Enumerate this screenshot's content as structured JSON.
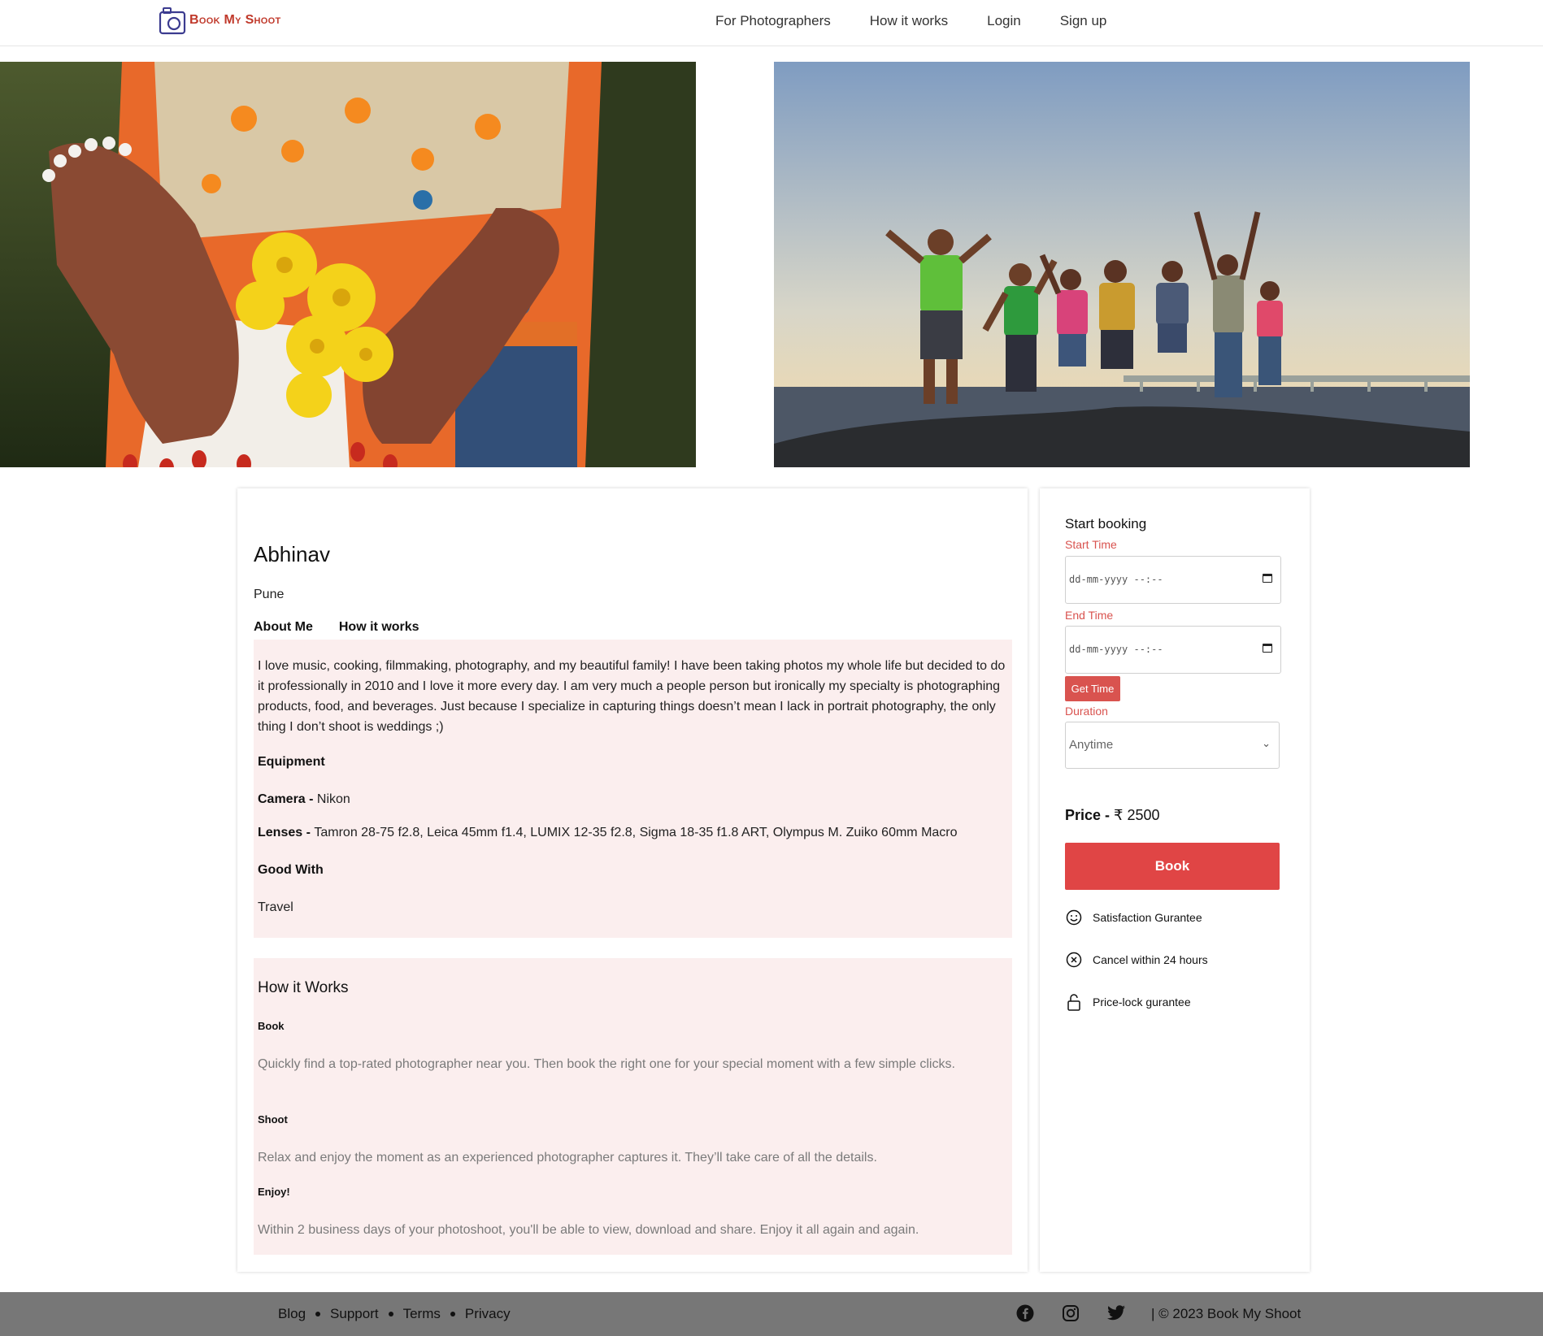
{
  "header": {
    "logo_text": "Book My Shoot",
    "nav": [
      "For Photographers",
      "How it works",
      "Login",
      "Sign up"
    ]
  },
  "profile": {
    "name": "Abhinav",
    "city": "Pune",
    "tabs": [
      "About Me",
      "How it works"
    ],
    "about": "I love music, cooking, filmmaking, photography, and my beautiful family! I have been taking photos my whole life but decided to do it professionally in 2010 and I love it more every day. I am very much a people person but ironically my specialty is photographing products, food, and beverages. Just because I specialize in capturing things doesn’t mean I lack in portrait photography, the only thing I don’t shoot is weddings ;)",
    "equipment_heading": "Equipment",
    "camera_label": "Camera - ",
    "camera_value": "Nikon",
    "lenses_label": "Lenses - ",
    "lenses_value": "Tamron 28-75 f2.8, Leica 45mm f1.4, LUMIX 12-35 f2.8, Sigma 18-35 f1.8 ART, Olympus M. Zuiko 60mm Macro",
    "good_with_heading": "Good With",
    "good_with_value": "Travel"
  },
  "how_it_works": {
    "title": "How it Works",
    "steps": [
      {
        "title": "Book",
        "desc": "Quickly find a top-rated photographer near you. Then book the right one for your special moment with a few simple clicks."
      },
      {
        "title": "Shoot",
        "desc": "Relax and enjoy the moment as an experienced photographer captures it. They’ll take care of all the details."
      },
      {
        "title": "Enjoy!",
        "desc": "Within 2 business days of your photoshoot, you'll be able to view, download and share. Enjoy it all again and again."
      }
    ]
  },
  "booking": {
    "title": "Start booking",
    "start_label": "Start Time",
    "end_label": "End Time",
    "datetime_placeholder": "dd-mm-yyyy --:--",
    "get_time": "Get Time",
    "duration_label": "Duration",
    "duration_value": "Anytime",
    "price_label": "Price - ",
    "price_value": "₹ 2500",
    "book": "Book",
    "features": [
      "Satisfaction Gurantee",
      "Cancel within 24 hours",
      "Price-lock gurantee"
    ]
  },
  "footer": {
    "links": [
      "Blog",
      "Support",
      "Terms",
      "Privacy"
    ],
    "social": [
      "facebook-icon",
      "instagram-icon",
      "twitter-icon"
    ],
    "copyright": "| © 2023 Book My Shoot"
  },
  "colors": {
    "accent": "#e04545",
    "label_red": "#d9534f",
    "pink_panel": "#fbeeee",
    "footer": "#777777"
  }
}
